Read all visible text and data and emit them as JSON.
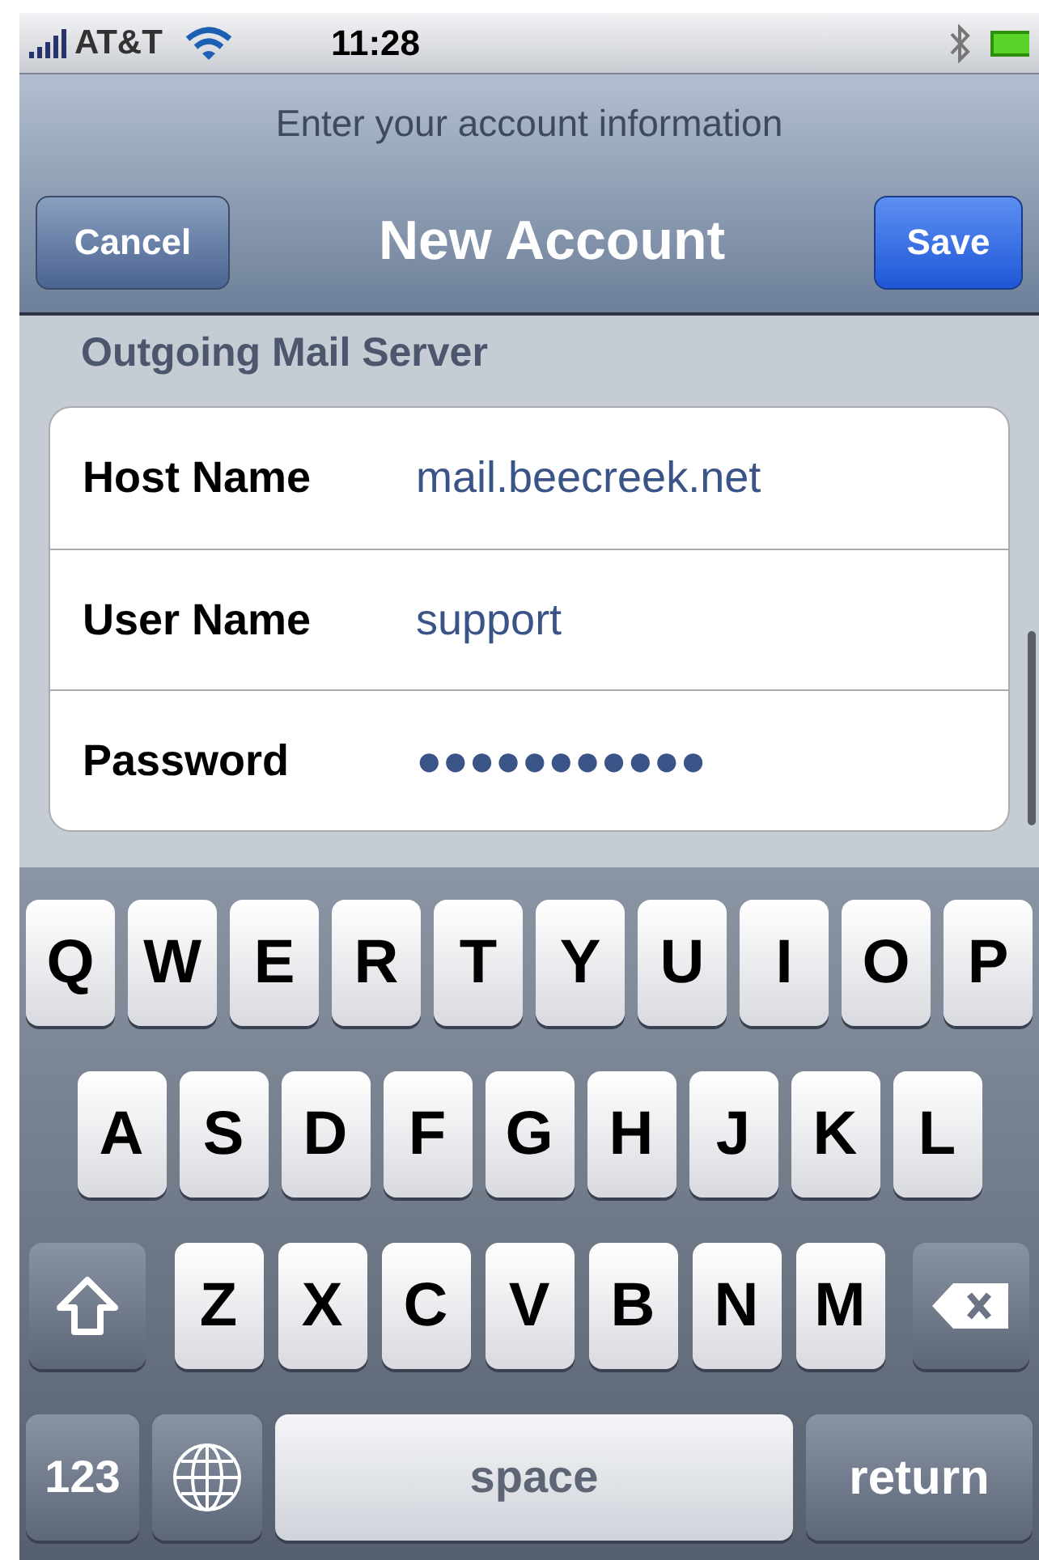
{
  "status_bar": {
    "carrier": "AT&T",
    "time": "11:28"
  },
  "nav": {
    "prompt": "Enter your account information",
    "title": "New Account",
    "left_button": "Cancel",
    "right_button": "Save"
  },
  "section": {
    "header": "Outgoing Mail Server",
    "fields": [
      {
        "label": "Host Name",
        "value": "mail.beecreek.net"
      },
      {
        "label": "User Name",
        "value": "support"
      },
      {
        "label": "Password",
        "value": "●●●●●●●●●●●"
      }
    ]
  },
  "keyboard": {
    "rows": [
      [
        {
          "kind": "letter",
          "label": "Q"
        },
        {
          "kind": "letter",
          "label": "W"
        },
        {
          "kind": "letter",
          "label": "E"
        },
        {
          "kind": "letter",
          "label": "R"
        },
        {
          "kind": "letter",
          "label": "T"
        },
        {
          "kind": "letter",
          "label": "Y"
        },
        {
          "kind": "letter",
          "label": "U"
        },
        {
          "kind": "letter",
          "label": "I"
        },
        {
          "kind": "letter",
          "label": "O"
        },
        {
          "kind": "letter",
          "label": "P"
        }
      ],
      [
        {
          "kind": "letter",
          "label": "A"
        },
        {
          "kind": "letter",
          "label": "S"
        },
        {
          "kind": "letter",
          "label": "D"
        },
        {
          "kind": "letter",
          "label": "F"
        },
        {
          "kind": "letter",
          "label": "G"
        },
        {
          "kind": "letter",
          "label": "H"
        },
        {
          "kind": "letter",
          "label": "J"
        },
        {
          "kind": "letter",
          "label": "K"
        },
        {
          "kind": "letter",
          "label": "L"
        }
      ],
      [
        {
          "kind": "shift"
        },
        {
          "kind": "letter",
          "label": "Z"
        },
        {
          "kind": "letter",
          "label": "X"
        },
        {
          "kind": "letter",
          "label": "C"
        },
        {
          "kind": "letter",
          "label": "V"
        },
        {
          "kind": "letter",
          "label": "B"
        },
        {
          "kind": "letter",
          "label": "N"
        },
        {
          "kind": "letter",
          "label": "M"
        },
        {
          "kind": "delete"
        }
      ]
    ],
    "bottom_bar": {
      "numbers_key": "123",
      "space_key": "space",
      "return_key": "return"
    }
  }
}
